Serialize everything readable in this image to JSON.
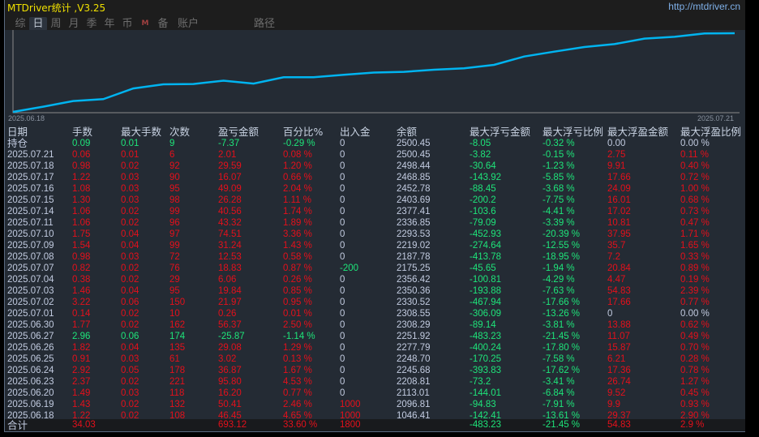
{
  "window": {
    "title": "MTDriver统计 ,V3.25",
    "url": "http://mtdriver.cn"
  },
  "tabs": [
    {
      "label": "综",
      "active": false
    },
    {
      "label": "日",
      "active": true
    },
    {
      "label": "周",
      "active": false
    },
    {
      "label": "月",
      "active": false
    },
    {
      "label": "季",
      "active": false
    },
    {
      "label": "年",
      "active": false
    },
    {
      "label": "币",
      "active": false
    },
    {
      "label": "M",
      "active": false
    },
    {
      "label": "备",
      "active": false
    },
    {
      "label": "账户",
      "active": false
    },
    {
      "label": "路径",
      "active": false
    }
  ],
  "chart": {
    "start_label": "2025.06.18",
    "end_label": "2025.07.21",
    "line_color": "#00b4f0"
  },
  "colors": {
    "profit": "#e5101b",
    "loss": "#1ee57a",
    "neutral": "#c2cbe0"
  },
  "table": {
    "headers": [
      "日期",
      "手数",
      "最大手数",
      "次数",
      "盈亏金额",
      "百分比%",
      "出入金",
      "余额",
      "最大浮亏金额",
      "最大浮亏比例",
      "最大浮盈金额",
      "最大浮盈比例"
    ],
    "rows": [
      [
        "持仓",
        "0.09",
        "0.01",
        "9",
        "-7.37",
        "-0.29 %",
        "0",
        "2500.45",
        "-8.05",
        "-0.32 %",
        "0.00",
        "0.00 %"
      ],
      [
        "2025.07.21",
        "0.06",
        "0.01",
        "6",
        "2.01",
        "0.08 %",
        "0",
        "2500.45",
        "-3.82",
        "-0.15 %",
        "2.75",
        "0.11 %"
      ],
      [
        "2025.07.18",
        "0.98",
        "0.02",
        "92",
        "29.59",
        "1.20 %",
        "0",
        "2498.44",
        "-30.64",
        "-1.23 %",
        "9.91",
        "0.40 %"
      ],
      [
        "2025.07.17",
        "1.22",
        "0.03",
        "90",
        "16.07",
        "0.66 %",
        "0",
        "2468.85",
        "-143.92",
        "-5.85 %",
        "17.66",
        "0.72 %"
      ],
      [
        "2025.07.16",
        "1.08",
        "0.03",
        "95",
        "49.09",
        "2.04 %",
        "0",
        "2452.78",
        "-88.45",
        "-3.68 %",
        "24.09",
        "1.00 %"
      ],
      [
        "2025.07.15",
        "1.30",
        "0.03",
        "98",
        "26.28",
        "1.11 %",
        "0",
        "2403.69",
        "-200.2",
        "-7.75 %",
        "16.01",
        "0.68 %"
      ],
      [
        "2025.07.14",
        "1.06",
        "0.02",
        "99",
        "40.56",
        "1.74 %",
        "0",
        "2377.41",
        "-103.6",
        "-4.41 %",
        "17.02",
        "0.73 %"
      ],
      [
        "2025.07.11",
        "1.06",
        "0.02",
        "96",
        "43.32",
        "1.89 %",
        "0",
        "2336.85",
        "-79.09",
        "-3.39 %",
        "10.81",
        "0.47 %"
      ],
      [
        "2025.07.10",
        "1.75",
        "0.04",
        "97",
        "74.51",
        "3.36 %",
        "0",
        "2293.53",
        "-452.93",
        "-20.39 %",
        "37.95",
        "1.71 %"
      ],
      [
        "2025.07.09",
        "1.54",
        "0.04",
        "99",
        "31.24",
        "1.43 %",
        "0",
        "2219.02",
        "-274.64",
        "-12.55 %",
        "35.7",
        "1.65 %"
      ],
      [
        "2025.07.08",
        "0.98",
        "0.03",
        "72",
        "12.53",
        "0.58 %",
        "0",
        "2187.78",
        "-413.78",
        "-18.95 %",
        "7.2",
        "0.33 %"
      ],
      [
        "2025.07.07",
        "0.82",
        "0.02",
        "76",
        "18.83",
        "0.87 %",
        "-200",
        "2175.25",
        "-45.65",
        "-1.94 %",
        "20.84",
        "0.89 %"
      ],
      [
        "2025.07.04",
        "0.38",
        "0.02",
        "29",
        "6.06",
        "0.26 %",
        "0",
        "2356.42",
        "-100.81",
        "-4.29 %",
        "4.47",
        "0.19 %"
      ],
      [
        "2025.07.03",
        "1.46",
        "0.04",
        "95",
        "19.84",
        "0.85 %",
        "0",
        "2350.36",
        "-193.88",
        "-7.63 %",
        "54.83",
        "2.39 %"
      ],
      [
        "2025.07.02",
        "3.22",
        "0.06",
        "150",
        "21.97",
        "0.95 %",
        "0",
        "2330.52",
        "-467.94",
        "-17.66 %",
        "17.66",
        "0.77 %"
      ],
      [
        "2025.07.01",
        "0.14",
        "0.02",
        "10",
        "0.26",
        "0.01 %",
        "0",
        "2308.55",
        "-306.09",
        "-13.26 %",
        "0",
        "0.00 %"
      ],
      [
        "2025.06.30",
        "1.77",
        "0.02",
        "162",
        "56.37",
        "2.50 %",
        "0",
        "2308.29",
        "-89.14",
        "-3.81 %",
        "13.88",
        "0.62 %"
      ],
      [
        "2025.06.27",
        "2.96",
        "0.06",
        "174",
        "-25.87",
        "-1.14 %",
        "0",
        "2251.92",
        "-483.23",
        "-21.45 %",
        "11.07",
        "0.49 %"
      ],
      [
        "2025.06.26",
        "1.82",
        "0.04",
        "135",
        "29.08",
        "1.29 %",
        "0",
        "2277.79",
        "-400.24",
        "-17.80 %",
        "15.87",
        "0.70 %"
      ],
      [
        "2025.06.25",
        "0.91",
        "0.03",
        "61",
        "3.02",
        "0.13 %",
        "0",
        "2248.70",
        "-170.25",
        "-7.58 %",
        "6.21",
        "0.28 %"
      ],
      [
        "2025.06.24",
        "2.92",
        "0.05",
        "178",
        "36.87",
        "1.67 %",
        "0",
        "2245.68",
        "-393.83",
        "-17.62 %",
        "17.36",
        "0.78 %"
      ],
      [
        "2025.06.23",
        "2.37",
        "0.02",
        "221",
        "95.80",
        "4.53 %",
        "0",
        "2208.81",
        "-73.2",
        "-3.41 %",
        "26.74",
        "1.27 %"
      ],
      [
        "2025.06.20",
        "1.49",
        "0.03",
        "118",
        "16.20",
        "0.77 %",
        "0",
        "2113.01",
        "-144.01",
        "-6.84 %",
        "9.52",
        "0.45 %"
      ],
      [
        "2025.06.19",
        "1.43",
        "0.02",
        "132",
        "50.41",
        "2.46 %",
        "1000",
        "2096.81",
        "-94.83",
        "-7.91 %",
        "9.9",
        "0.93 %"
      ],
      [
        "2025.06.18",
        "1.22",
        "0.02",
        "108",
        "46.45",
        "4.65 %",
        "1000",
        "1046.41",
        "-142.41",
        "-13.61 %",
        "29.37",
        "2.90 %"
      ]
    ],
    "total": [
      "合计",
      "34.03",
      "",
      "",
      "693.12",
      "33.60 %",
      "1800",
      "",
      "-483.23",
      "-21.45 %",
      "54.83",
      "2.9 %"
    ]
  }
}
